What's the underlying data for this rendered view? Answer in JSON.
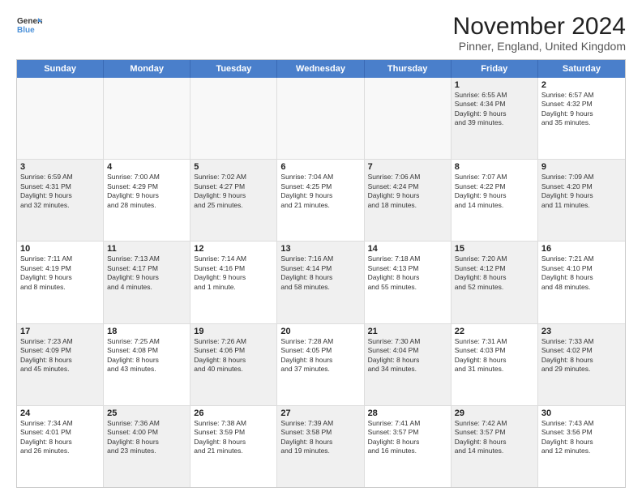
{
  "logo": {
    "line1": "General",
    "line2": "Blue"
  },
  "title": "November 2024",
  "subtitle": "Pinner, England, United Kingdom",
  "days": [
    "Sunday",
    "Monday",
    "Tuesday",
    "Wednesday",
    "Thursday",
    "Friday",
    "Saturday"
  ],
  "rows": [
    [
      {
        "day": "",
        "lines": [],
        "empty": true
      },
      {
        "day": "",
        "lines": [],
        "empty": true
      },
      {
        "day": "",
        "lines": [],
        "empty": true
      },
      {
        "day": "",
        "lines": [],
        "empty": true
      },
      {
        "day": "",
        "lines": [],
        "empty": true
      },
      {
        "day": "1",
        "lines": [
          "Sunrise: 6:55 AM",
          "Sunset: 4:34 PM",
          "Daylight: 9 hours",
          "and 39 minutes."
        ],
        "shaded": true
      },
      {
        "day": "2",
        "lines": [
          "Sunrise: 6:57 AM",
          "Sunset: 4:32 PM",
          "Daylight: 9 hours",
          "and 35 minutes."
        ],
        "shaded": false
      }
    ],
    [
      {
        "day": "3",
        "lines": [
          "Sunrise: 6:59 AM",
          "Sunset: 4:31 PM",
          "Daylight: 9 hours",
          "and 32 minutes."
        ],
        "shaded": true
      },
      {
        "day": "4",
        "lines": [
          "Sunrise: 7:00 AM",
          "Sunset: 4:29 PM",
          "Daylight: 9 hours",
          "and 28 minutes."
        ],
        "shaded": false
      },
      {
        "day": "5",
        "lines": [
          "Sunrise: 7:02 AM",
          "Sunset: 4:27 PM",
          "Daylight: 9 hours",
          "and 25 minutes."
        ],
        "shaded": true
      },
      {
        "day": "6",
        "lines": [
          "Sunrise: 7:04 AM",
          "Sunset: 4:25 PM",
          "Daylight: 9 hours",
          "and 21 minutes."
        ],
        "shaded": false
      },
      {
        "day": "7",
        "lines": [
          "Sunrise: 7:06 AM",
          "Sunset: 4:24 PM",
          "Daylight: 9 hours",
          "and 18 minutes."
        ],
        "shaded": true
      },
      {
        "day": "8",
        "lines": [
          "Sunrise: 7:07 AM",
          "Sunset: 4:22 PM",
          "Daylight: 9 hours",
          "and 14 minutes."
        ],
        "shaded": false
      },
      {
        "day": "9",
        "lines": [
          "Sunrise: 7:09 AM",
          "Sunset: 4:20 PM",
          "Daylight: 9 hours",
          "and 11 minutes."
        ],
        "shaded": true
      }
    ],
    [
      {
        "day": "10",
        "lines": [
          "Sunrise: 7:11 AM",
          "Sunset: 4:19 PM",
          "Daylight: 9 hours",
          "and 8 minutes."
        ],
        "shaded": false
      },
      {
        "day": "11",
        "lines": [
          "Sunrise: 7:13 AM",
          "Sunset: 4:17 PM",
          "Daylight: 9 hours",
          "and 4 minutes."
        ],
        "shaded": true
      },
      {
        "day": "12",
        "lines": [
          "Sunrise: 7:14 AM",
          "Sunset: 4:16 PM",
          "Daylight: 9 hours",
          "and 1 minute."
        ],
        "shaded": false
      },
      {
        "day": "13",
        "lines": [
          "Sunrise: 7:16 AM",
          "Sunset: 4:14 PM",
          "Daylight: 8 hours",
          "and 58 minutes."
        ],
        "shaded": true
      },
      {
        "day": "14",
        "lines": [
          "Sunrise: 7:18 AM",
          "Sunset: 4:13 PM",
          "Daylight: 8 hours",
          "and 55 minutes."
        ],
        "shaded": false
      },
      {
        "day": "15",
        "lines": [
          "Sunrise: 7:20 AM",
          "Sunset: 4:12 PM",
          "Daylight: 8 hours",
          "and 52 minutes."
        ],
        "shaded": true
      },
      {
        "day": "16",
        "lines": [
          "Sunrise: 7:21 AM",
          "Sunset: 4:10 PM",
          "Daylight: 8 hours",
          "and 48 minutes."
        ],
        "shaded": false
      }
    ],
    [
      {
        "day": "17",
        "lines": [
          "Sunrise: 7:23 AM",
          "Sunset: 4:09 PM",
          "Daylight: 8 hours",
          "and 45 minutes."
        ],
        "shaded": true
      },
      {
        "day": "18",
        "lines": [
          "Sunrise: 7:25 AM",
          "Sunset: 4:08 PM",
          "Daylight: 8 hours",
          "and 43 minutes."
        ],
        "shaded": false
      },
      {
        "day": "19",
        "lines": [
          "Sunrise: 7:26 AM",
          "Sunset: 4:06 PM",
          "Daylight: 8 hours",
          "and 40 minutes."
        ],
        "shaded": true
      },
      {
        "day": "20",
        "lines": [
          "Sunrise: 7:28 AM",
          "Sunset: 4:05 PM",
          "Daylight: 8 hours",
          "and 37 minutes."
        ],
        "shaded": false
      },
      {
        "day": "21",
        "lines": [
          "Sunrise: 7:30 AM",
          "Sunset: 4:04 PM",
          "Daylight: 8 hours",
          "and 34 minutes."
        ],
        "shaded": true
      },
      {
        "day": "22",
        "lines": [
          "Sunrise: 7:31 AM",
          "Sunset: 4:03 PM",
          "Daylight: 8 hours",
          "and 31 minutes."
        ],
        "shaded": false
      },
      {
        "day": "23",
        "lines": [
          "Sunrise: 7:33 AM",
          "Sunset: 4:02 PM",
          "Daylight: 8 hours",
          "and 29 minutes."
        ],
        "shaded": true
      }
    ],
    [
      {
        "day": "24",
        "lines": [
          "Sunrise: 7:34 AM",
          "Sunset: 4:01 PM",
          "Daylight: 8 hours",
          "and 26 minutes."
        ],
        "shaded": false
      },
      {
        "day": "25",
        "lines": [
          "Sunrise: 7:36 AM",
          "Sunset: 4:00 PM",
          "Daylight: 8 hours",
          "and 23 minutes."
        ],
        "shaded": true
      },
      {
        "day": "26",
        "lines": [
          "Sunrise: 7:38 AM",
          "Sunset: 3:59 PM",
          "Daylight: 8 hours",
          "and 21 minutes."
        ],
        "shaded": false
      },
      {
        "day": "27",
        "lines": [
          "Sunrise: 7:39 AM",
          "Sunset: 3:58 PM",
          "Daylight: 8 hours",
          "and 19 minutes."
        ],
        "shaded": true
      },
      {
        "day": "28",
        "lines": [
          "Sunrise: 7:41 AM",
          "Sunset: 3:57 PM",
          "Daylight: 8 hours",
          "and 16 minutes."
        ],
        "shaded": false
      },
      {
        "day": "29",
        "lines": [
          "Sunrise: 7:42 AM",
          "Sunset: 3:57 PM",
          "Daylight: 8 hours",
          "and 14 minutes."
        ],
        "shaded": true
      },
      {
        "day": "30",
        "lines": [
          "Sunrise: 7:43 AM",
          "Sunset: 3:56 PM",
          "Daylight: 8 hours",
          "and 12 minutes."
        ],
        "shaded": false
      }
    ]
  ]
}
